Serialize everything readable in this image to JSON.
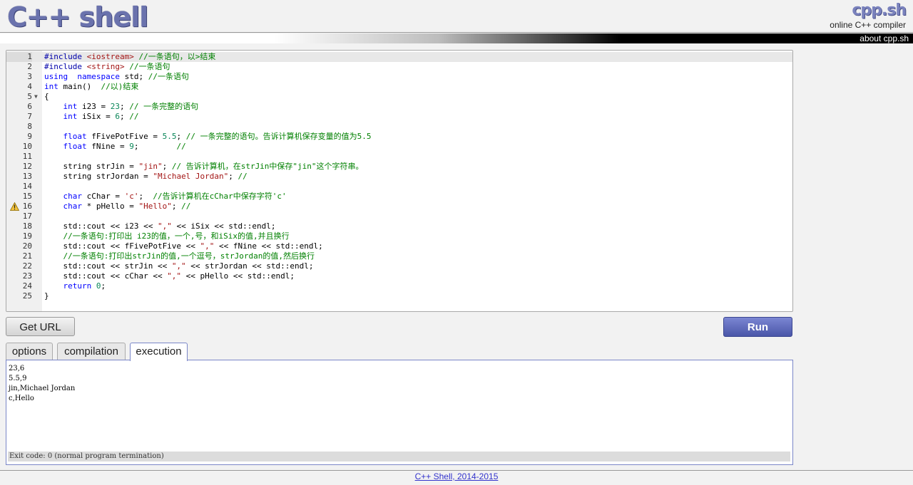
{
  "header": {
    "logo": "C++ shell",
    "brand": "cpp.sh",
    "brand_sub": "online C++ compiler",
    "about": "about cpp.sh"
  },
  "editor": {
    "lines": [
      {
        "n": "1",
        "active": true,
        "fold": false,
        "warn": false,
        "tokens": [
          [
            "pp",
            "#include "
          ],
          [
            "st",
            "<iostream>"
          ],
          [
            "cm",
            " //一条语句，以>结束"
          ]
        ]
      },
      {
        "n": "2",
        "tokens": [
          [
            "pp",
            "#include "
          ],
          [
            "st",
            "<string>"
          ],
          [
            "cm",
            " //一条语句"
          ]
        ]
      },
      {
        "n": "3",
        "tokens": [
          [
            "kw",
            "using"
          ],
          [
            "",
            "  "
          ],
          [
            "kw",
            "namespace"
          ],
          [
            "",
            " std; "
          ],
          [
            "cm",
            "//一条语句"
          ]
        ]
      },
      {
        "n": "4",
        "tokens": [
          [
            "kw",
            "int"
          ],
          [
            "",
            " main()  "
          ],
          [
            "cm",
            "//以)结束"
          ]
        ]
      },
      {
        "n": "5",
        "fold": true,
        "tokens": [
          [
            "",
            "{"
          ]
        ]
      },
      {
        "n": "6",
        "tokens": [
          [
            "",
            "    "
          ],
          [
            "kw",
            "int"
          ],
          [
            "",
            " i23 = "
          ],
          [
            "nm",
            "23"
          ],
          [
            "",
            "; "
          ],
          [
            "cm",
            "// 一条完整的语句"
          ]
        ]
      },
      {
        "n": "7",
        "tokens": [
          [
            "",
            "    "
          ],
          [
            "kw",
            "int"
          ],
          [
            "",
            " iSix = "
          ],
          [
            "nm",
            "6"
          ],
          [
            "",
            "; "
          ],
          [
            "cm",
            "//"
          ]
        ]
      },
      {
        "n": "8",
        "tokens": []
      },
      {
        "n": "9",
        "tokens": [
          [
            "",
            "    "
          ],
          [
            "kw",
            "float"
          ],
          [
            "",
            " fFivePotFive = "
          ],
          [
            "nm",
            "5.5"
          ],
          [
            "",
            "; "
          ],
          [
            "cm",
            "// 一条完整的语句。告诉计算机保存变量的值为5.5"
          ]
        ]
      },
      {
        "n": "10",
        "tokens": [
          [
            "",
            "    "
          ],
          [
            "kw",
            "float"
          ],
          [
            "",
            " fNine = "
          ],
          [
            "nm",
            "9"
          ],
          [
            "",
            ";        "
          ],
          [
            "cm",
            "//"
          ]
        ]
      },
      {
        "n": "11",
        "tokens": []
      },
      {
        "n": "12",
        "tokens": [
          [
            "",
            "    string strJin = "
          ],
          [
            "st",
            "\"jin\""
          ],
          [
            "",
            "; "
          ],
          [
            "cm",
            "// 告诉计算机，在strJin中保存\"jin\"这个字符串。"
          ]
        ]
      },
      {
        "n": "13",
        "tokens": [
          [
            "",
            "    string strJordan = "
          ],
          [
            "st",
            "\"Michael Jordan\""
          ],
          [
            "",
            "; "
          ],
          [
            "cm",
            "//"
          ]
        ]
      },
      {
        "n": "14",
        "tokens": []
      },
      {
        "n": "15",
        "tokens": [
          [
            "",
            "    "
          ],
          [
            "kw",
            "char"
          ],
          [
            "",
            " cChar = "
          ],
          [
            "st",
            "'c'"
          ],
          [
            "",
            ";  "
          ],
          [
            "cm",
            "//告诉计算机在cChar中保存字符'c'"
          ]
        ]
      },
      {
        "n": "16",
        "warn": true,
        "tokens": [
          [
            "",
            "    "
          ],
          [
            "kw",
            "char"
          ],
          [
            "",
            " * pHello = "
          ],
          [
            "st",
            "\"Hello\""
          ],
          [
            "",
            "; "
          ],
          [
            "cm",
            "//"
          ]
        ]
      },
      {
        "n": "17",
        "tokens": []
      },
      {
        "n": "18",
        "tokens": [
          [
            "",
            "    std::cout << i23 << "
          ],
          [
            "st",
            "\",\""
          ],
          [
            "",
            " << iSix << std::endl;"
          ]
        ]
      },
      {
        "n": "19",
        "tokens": [
          [
            "",
            "    "
          ],
          [
            "cm",
            "//一条语句:打印出 i23的值，一个,号，和iSix的值,并且换行"
          ]
        ]
      },
      {
        "n": "20",
        "tokens": [
          [
            "",
            "    std::cout << fFivePotFive << "
          ],
          [
            "st",
            "\",\""
          ],
          [
            "",
            " << fNine << std::endl;"
          ]
        ]
      },
      {
        "n": "21",
        "tokens": [
          [
            "",
            "    "
          ],
          [
            "cm",
            "//一条语句:打印出strJin的值,一个逗号，strJordan的值,然后换行"
          ]
        ]
      },
      {
        "n": "22",
        "tokens": [
          [
            "",
            "    std::cout << strJin << "
          ],
          [
            "st",
            "\",\""
          ],
          [
            "",
            " << strJordan << std::endl;"
          ]
        ]
      },
      {
        "n": "23",
        "tokens": [
          [
            "",
            "    std::cout << cChar << "
          ],
          [
            "st",
            "\",\""
          ],
          [
            "",
            " << pHello << std::endl;"
          ]
        ]
      },
      {
        "n": "24",
        "tokens": [
          [
            "",
            "    "
          ],
          [
            "kw",
            "return"
          ],
          [
            "",
            " "
          ],
          [
            "nm",
            "0"
          ],
          [
            "",
            ";"
          ]
        ]
      },
      {
        "n": "25",
        "tokens": [
          [
            "",
            "}"
          ]
        ]
      }
    ]
  },
  "buttons": {
    "get_url": "Get URL",
    "run": "Run"
  },
  "tabs": [
    {
      "label": "options",
      "active": false
    },
    {
      "label": "compilation",
      "active": false
    },
    {
      "label": "execution",
      "active": true
    }
  ],
  "output": {
    "lines": [
      "23,6",
      "5.5,9",
      "jin,Michael Jordan",
      "c,Hello"
    ],
    "exit_status": "Exit code: 0 (normal program termination)"
  },
  "footer": {
    "link": "C++ Shell, 2014-2015"
  }
}
